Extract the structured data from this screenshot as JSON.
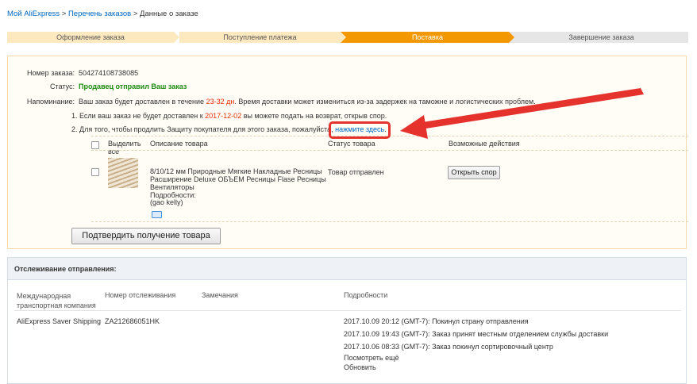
{
  "breadcrumb": {
    "my_aliexpress": "Мой AliExpress",
    "sep1": ">",
    "orders_list": "Перечень заказов",
    "sep2": ">",
    "current": "Данные о заказе"
  },
  "steps": [
    {
      "label": "Оформление заказа",
      "state": "done"
    },
    {
      "label": "Поступление платежа",
      "state": "done"
    },
    {
      "label": "Поставка",
      "state": "active"
    },
    {
      "label": "Завершение заказа",
      "state": "todo"
    }
  ],
  "order": {
    "number_label": "Номер заказа:",
    "number_value": "504274108738085",
    "status_label": "Статус:",
    "status_value": "Продавец отправил Ваш заказ",
    "reminder_label": "Напоминание:",
    "reminder_prefix": "Ваш заказ будет доставлен в течение",
    "reminder_days": "23-32 дн",
    "reminder_suffix": ". Время доставки может измениться из-за задержек на таможне и логистических проблем.",
    "note1_prefix": "1. Если ваш заказ не будет доставлен к",
    "note1_date": "2017-12-02",
    "note1_suffix": "вы можете подать на возврат, открыв спор.",
    "note2_prefix": "2. Для того, чтобы продлить Защиту покупателя для этого заказа, пожалуйста,",
    "note2_link": "нажмите здесь",
    "note2_end": "."
  },
  "items_table": {
    "headers": {
      "select_all": "Выделить все",
      "description": "Описание товара",
      "status": "Статус товара",
      "actions": "Возможные действия"
    },
    "rows": [
      {
        "title": "8/10/12 мм Природные Мягкие Накладные Ресницы Расширение Deluxe ОБЪЕМ Ресницы Flase Ресницы Вентиляторы",
        "details_label": "Подробности:",
        "details_value": "(gao kelly)",
        "status": "Товар отправлен",
        "action": "Открыть спор"
      }
    ],
    "confirm_button": "Подтвердить получение товара"
  },
  "tracking": {
    "title": "Отслеживание отправления:",
    "headers": {
      "carrier": "Международная транспортная компания",
      "number": "Номер отслеживания",
      "remarks": "Замечания",
      "details": "Подробности"
    },
    "rows": [
      {
        "carrier": "AliExpress Saver Shipping",
        "number": "ZA212686051HK",
        "remarks": "",
        "events": [
          "2017.10.09 20:12 (GMT-7): Покинул страну отправления",
          "2017.10.09 19:43 (GMT-7): Заказ принят местным отделением службы доставки",
          "2017.10.06 08:33 (GMT-7): Заказ покинул сортировочный центр"
        ],
        "more_link": "Посмотреть ещё",
        "refresh_link": "Обновить"
      }
    ]
  },
  "colors": {
    "link": "#0066c0",
    "status_green": "#1c8a0f",
    "accent_red": "#e62e04",
    "step_active": "#f39800",
    "step_done": "#fde9bf",
    "annotation_red": "#e5322d"
  }
}
